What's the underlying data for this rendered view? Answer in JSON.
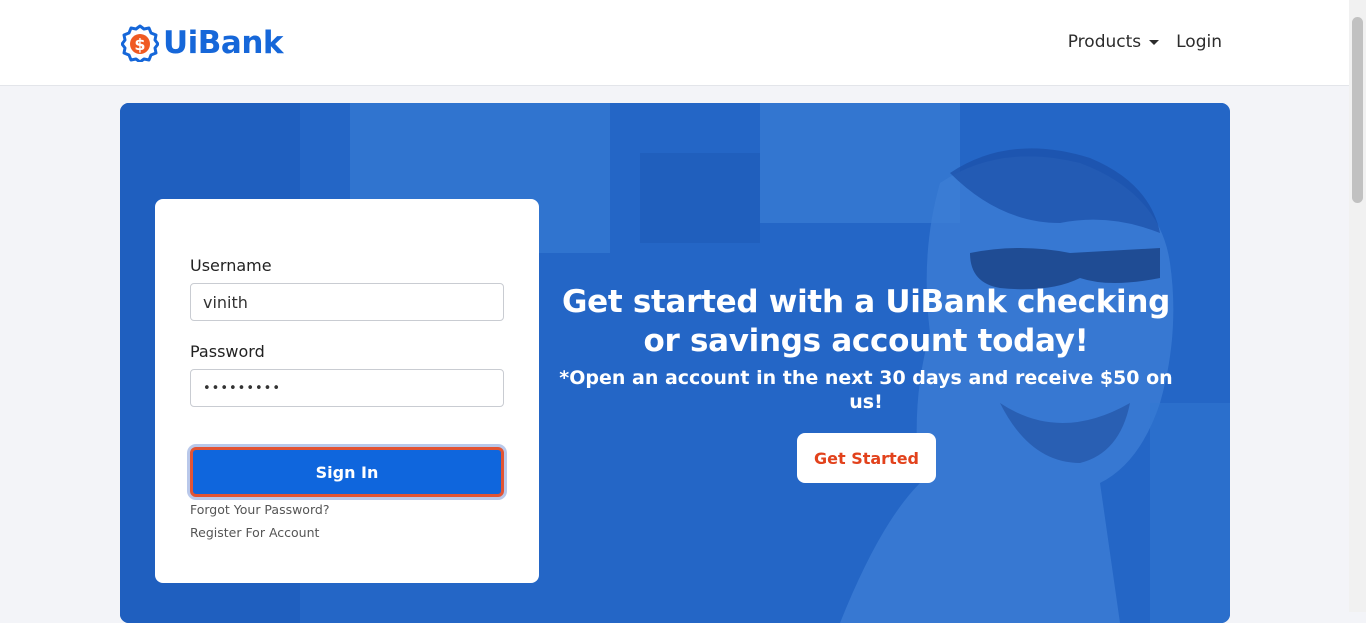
{
  "header": {
    "brand_name": "UiBank",
    "logo_icon": "dollar-badge-icon",
    "nav": {
      "products_label": "Products",
      "login_label": "Login"
    }
  },
  "login_form": {
    "username_label": "Username",
    "username_value": "vinith",
    "password_label": "Password",
    "password_value": "•••••••••",
    "sign_in_label": "Sign In",
    "forgot_password_label": "Forgot Your Password?",
    "register_label": "Register For Account"
  },
  "hero": {
    "title": "Get started with a UiBank checking or savings account today!",
    "subtitle": "*Open an account in the next 30 days and receive $50 on us!",
    "cta_label": "Get Started"
  },
  "colors": {
    "brand_blue": "#1667d9",
    "hero_blue": "#2f74d0",
    "primary_button": "#0f66dd",
    "accent_orange": "#e2421c"
  }
}
